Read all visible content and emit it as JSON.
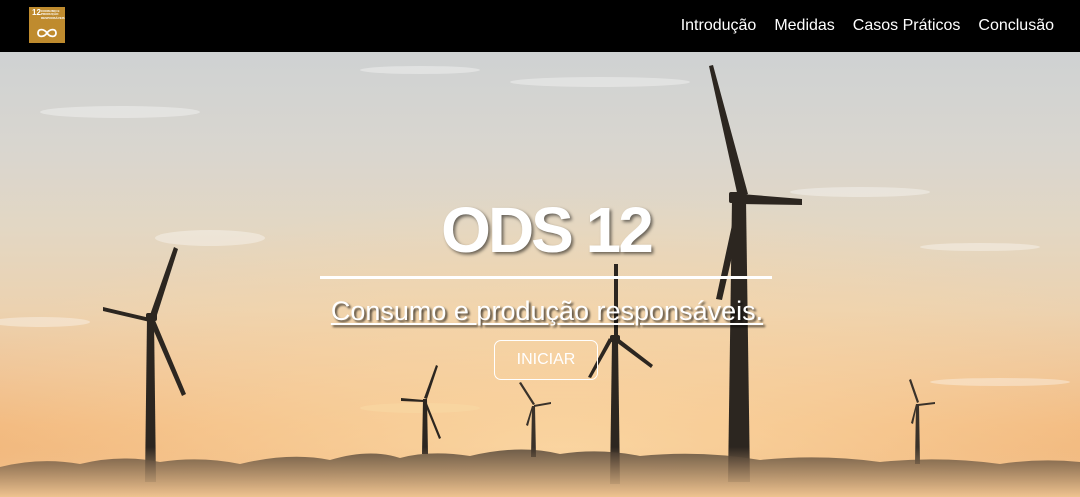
{
  "navbar": {
    "logo": {
      "number": "12",
      "text": "CONSUMO E PRODUÇÃO RESPONSÁVEIS",
      "icon": "infinity-icon",
      "color": "#BF8B2E"
    },
    "links": [
      {
        "label": "Introdução"
      },
      {
        "label": "Medidas"
      },
      {
        "label": "Casos Práticos"
      },
      {
        "label": "Conclusão"
      }
    ]
  },
  "hero": {
    "title": "ODS 12",
    "subtitle": "Consumo e produção responsáveis.",
    "button_label": "INICIAR",
    "background_image": "wind-turbines-at-sunset"
  }
}
